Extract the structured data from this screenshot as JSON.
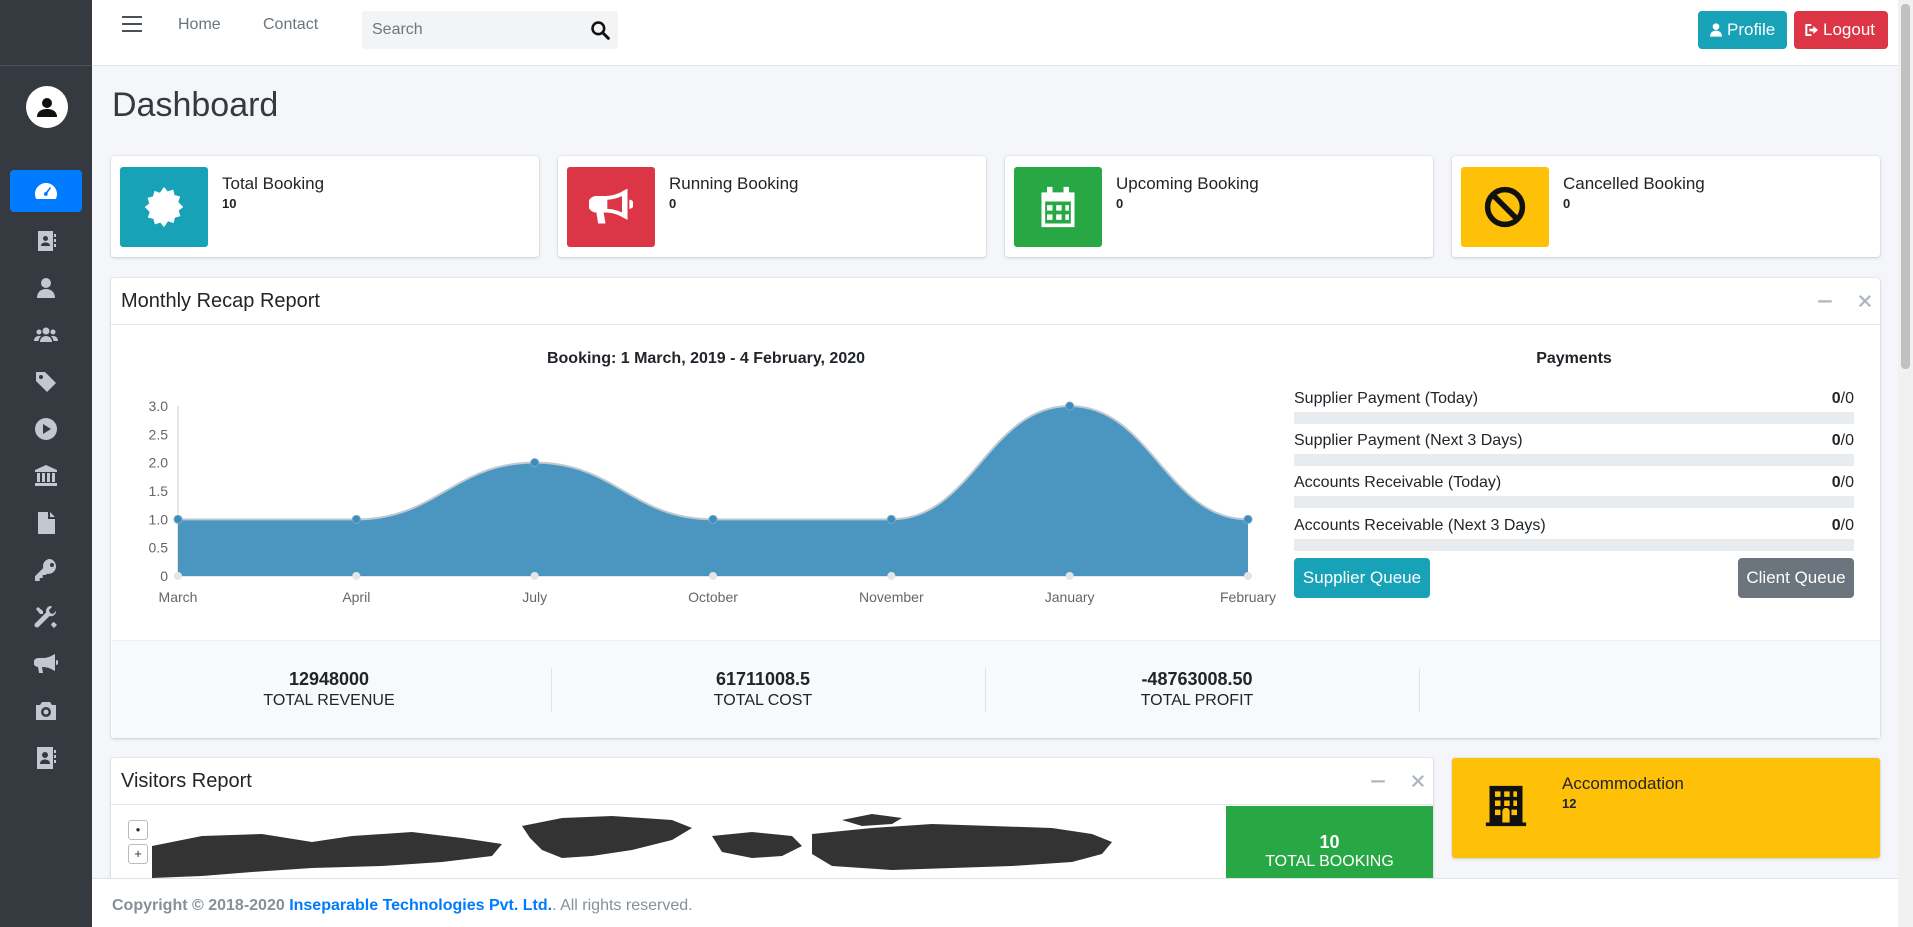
{
  "topbar": {
    "nav": [
      "Home",
      "Contact"
    ],
    "search_placeholder": "Search",
    "profile_label": "Profile",
    "logout_label": "Logout"
  },
  "sidebar": {
    "icons": [
      "dashboard-gauge-icon",
      "address-book-icon",
      "user-icon",
      "users-icon",
      "tag-icon",
      "play-circle-icon",
      "bank-icon",
      "file-icon",
      "key-icon",
      "tools-icon",
      "bullhorn-icon",
      "camera-icon",
      "contact-card-icon"
    ]
  },
  "page": {
    "title": "Dashboard"
  },
  "info_boxes": [
    {
      "label": "Total Booking",
      "value": "10",
      "color": "#17a2b8",
      "icon": "certificate-icon"
    },
    {
      "label": "Running Booking",
      "value": "0",
      "color": "#dc3545",
      "icon": "bullhorn-icon"
    },
    {
      "label": "Upcoming Booking",
      "value": "0",
      "color": "#28a745",
      "icon": "calendar-icon"
    },
    {
      "label": "Cancelled Booking",
      "value": "0",
      "color": "#ffc107",
      "icon": "ban-icon"
    }
  ],
  "recap": {
    "title": "Monthly Recap Report",
    "payments_title": "Payments",
    "payments": [
      {
        "label": "Supplier Payment (Today)",
        "done": "0",
        "total": "/0"
      },
      {
        "label": "Supplier Payment (Next 3 Days)",
        "done": "0",
        "total": "/0"
      },
      {
        "label": "Accounts Receivable (Today)",
        "done": "0",
        "total": "/0"
      },
      {
        "label": "Accounts Receivable (Next 3 Days)",
        "done": "0",
        "total": "/0"
      }
    ],
    "supplier_queue": "Supplier Queue",
    "client_queue": "Client Queue",
    "stats": [
      {
        "value": "12948000",
        "label": "TOTAL REVENUE"
      },
      {
        "value": "61711008.5",
        "label": "TOTAL COST"
      },
      {
        "value": "-48763008.50",
        "label": "TOTAL PROFIT"
      }
    ]
  },
  "chart_data": {
    "type": "area",
    "title": "Booking: 1 March, 2019 - 4 February, 2020",
    "categories": [
      "March",
      "April",
      "July",
      "October",
      "November",
      "January",
      "February"
    ],
    "values": [
      1,
      1,
      2,
      1,
      1,
      3,
      1
    ],
    "ylim": [
      0,
      3
    ],
    "yticks": [
      "0",
      "0.5",
      "1.0",
      "1.5",
      "2.0",
      "2.5",
      "3.0"
    ],
    "color": "#3c8dbc",
    "grid": false
  },
  "visitors": {
    "title": "Visitors Report",
    "total_value": "10",
    "total_label": "TOTAL BOOKING"
  },
  "accommodation": {
    "label": "Accommodation",
    "value": "12"
  },
  "footer": {
    "prefix": "Copyright © 2018-2020 ",
    "company": "Inseparable Technologies Pvt. Ltd.",
    "suffix": ". All rights reserved."
  }
}
